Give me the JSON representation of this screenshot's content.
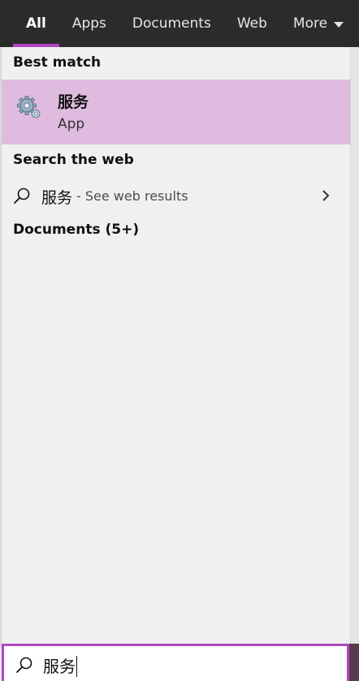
{
  "tabs": [
    {
      "label": "All",
      "active": true
    },
    {
      "label": "Apps",
      "active": false
    },
    {
      "label": "Documents",
      "active": false
    },
    {
      "label": "Web",
      "active": false
    },
    {
      "label": "More",
      "active": false
    }
  ],
  "sections": {
    "best_match": "Best match",
    "search_web": "Search the web",
    "documents": "Documents (5+)"
  },
  "best_match_item": {
    "title": "服务",
    "subtitle": "App",
    "icon": "services-gear-icon"
  },
  "web_result": {
    "query": "服务",
    "hint": "- See web results",
    "icon": "search-icon",
    "chevron": "chevron-right-icon"
  },
  "search_box": {
    "value": "服务",
    "icon": "search-icon"
  },
  "colors": {
    "accent": "#b146c2",
    "tabbar_bg": "#2b2b2b",
    "selected_bg": "#e0bbe0",
    "panel_bg": "#f0f0f0"
  }
}
